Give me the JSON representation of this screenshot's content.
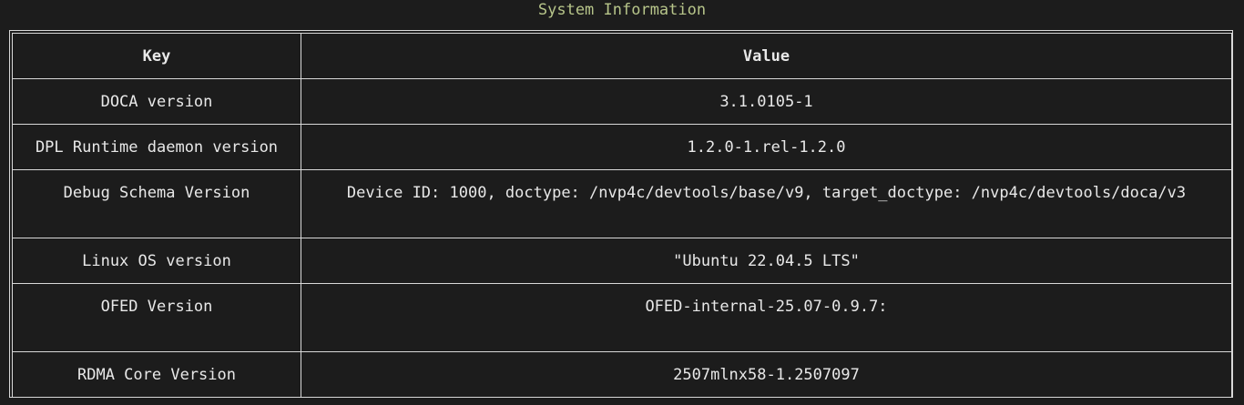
{
  "title": "System Information",
  "table": {
    "headers": {
      "key": "Key",
      "value": "Value"
    },
    "rows": [
      {
        "key": "DOCA version",
        "value": "3.1.0105-1"
      },
      {
        "key": "DPL Runtime daemon version",
        "value": "1.2.0-1.rel-1.2.0"
      },
      {
        "key": "Debug Schema Version",
        "value": "Device ID: 1000, doctype: /nvp4c/devtools/base/v9, target_doctype: /nvp4c/devtools/doca/v3"
      },
      {
        "key": "Linux OS version",
        "value": "\"Ubuntu 22.04.5 LTS\""
      },
      {
        "key": "OFED Version",
        "value": "OFED-internal-25.07-0.9.7:"
      },
      {
        "key": "RDMA Core Version",
        "value": "2507mlnx58-1.2507097"
      }
    ]
  }
}
